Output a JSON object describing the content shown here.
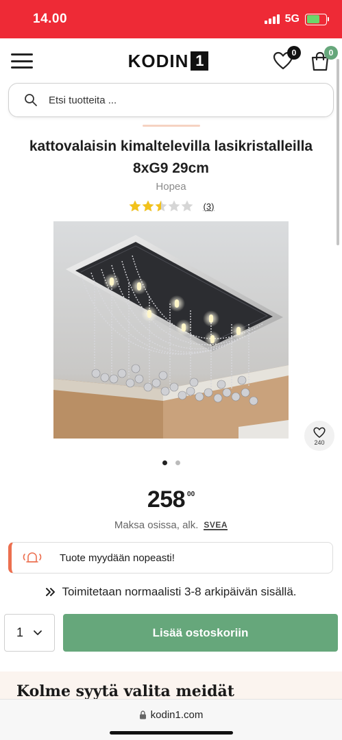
{
  "status_bar": {
    "time": "14.00",
    "network": "5G"
  },
  "header": {
    "logo_text": "KODIN",
    "logo_number": "1",
    "wishlist_count": "0",
    "cart_count": "0"
  },
  "search": {
    "placeholder": "Etsi tuotteita ..."
  },
  "product": {
    "title": "kattovalaisin kimaltelevilla lasikristalleilla 8xG9 29cm",
    "variant": "Hopea",
    "rating": 2.5,
    "rating_max": 5,
    "review_count": "(3)",
    "image_count": 2,
    "active_image": 1,
    "wishlist_saves": "240"
  },
  "price": {
    "main": "258",
    "cents": "00",
    "installment_text": "Maksa osissa, alk.",
    "installment_provider": "SVEA"
  },
  "notice": {
    "text": "Tuote myydään nopeasti!"
  },
  "delivery": {
    "text": "Toimitetaan normaalisti 3-8 arkipäivän sisällä."
  },
  "cart": {
    "quantity": "1",
    "add_label": "Lisää ostoskoriin"
  },
  "reasons": {
    "title": "Kolme syytä valita meidät"
  },
  "browser": {
    "url": "kodin1.com"
  },
  "colors": {
    "status_bar": "#ee2a36",
    "wishlist_badge": "#111111",
    "cart_badge": "#66a77b",
    "add_to_cart": "#66a77b",
    "notice_accent": "#ec6f4f",
    "star_filled": "#f2c21b",
    "star_empty": "#d6d6d6"
  }
}
